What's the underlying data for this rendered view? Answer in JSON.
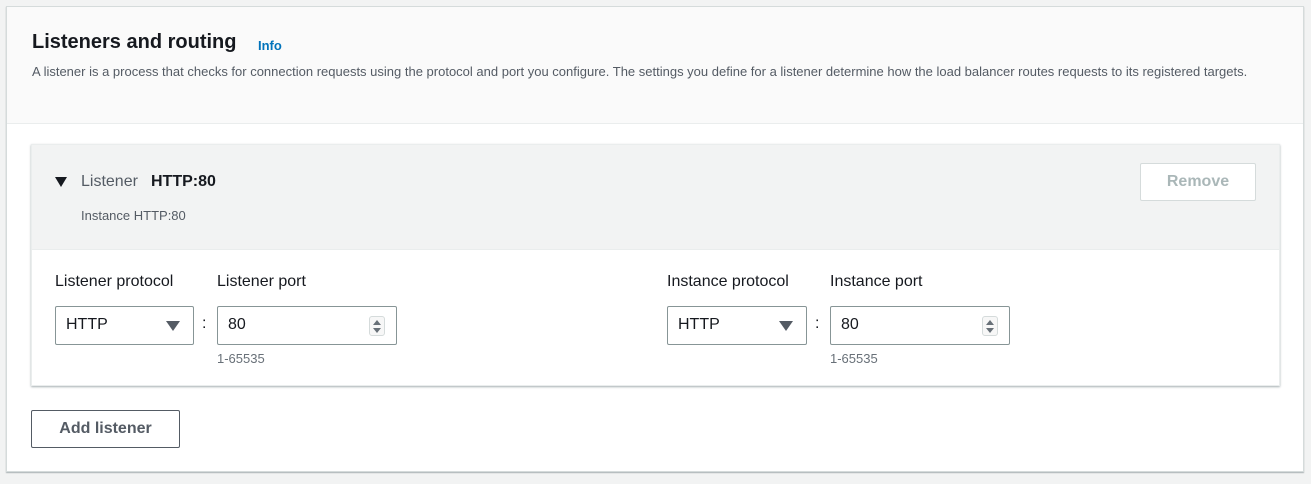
{
  "section": {
    "title": "Listeners and routing",
    "info_label": "Info",
    "description": "A listener is a process that checks for connection requests using the protocol and port you configure. The settings you define for a listener determine how the load balancer routes requests to its registered targets."
  },
  "listener": {
    "label": "Listener",
    "name": "HTTP:80",
    "subtitle": "Instance HTTP:80",
    "remove_label": "Remove",
    "listener_protocol": {
      "label": "Listener protocol",
      "value": "HTTP"
    },
    "listener_port": {
      "label": "Listener port",
      "value": "80",
      "hint": "1-65535"
    },
    "instance_protocol": {
      "label": "Instance protocol",
      "value": "HTTP"
    },
    "instance_port": {
      "label": "Instance port",
      "value": "80",
      "hint": "1-65535"
    },
    "separator": ":"
  },
  "actions": {
    "add_listener_label": "Add listener"
  },
  "colors": {
    "link": "#0073bb",
    "text_primary": "#16191f",
    "text_secondary": "#545b64",
    "disabled": "#aab7b8",
    "border": "#879596"
  },
  "icons": {
    "caret": "caret-down-icon",
    "select_arrow": "triangle-down-icon",
    "spinner": "number-spinner-icon"
  }
}
